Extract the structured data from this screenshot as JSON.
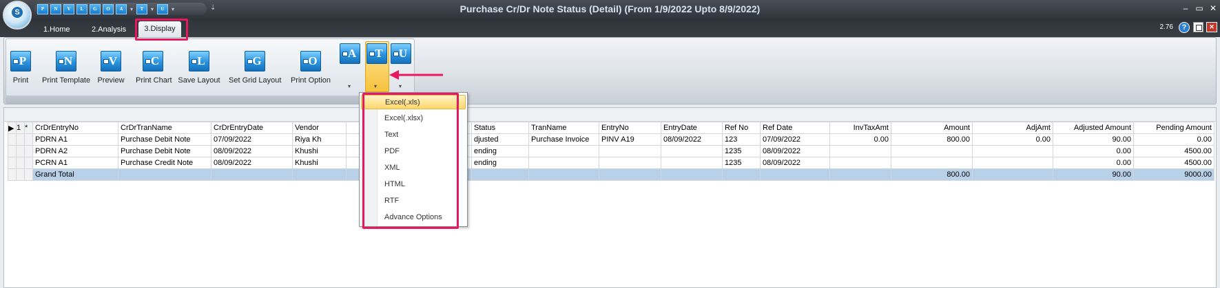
{
  "window": {
    "title": "Purchase Cr/Dr Note Status (Detail)  (From 1/9/2022 Upto 8/9/2022)",
    "minimize": "–",
    "maximize": "▭",
    "close": "✕",
    "version": "2.76"
  },
  "quick_access": [
    "P",
    "N",
    "V",
    "L",
    "G",
    "O",
    "A",
    "T",
    "U"
  ],
  "tabs": [
    {
      "label": "1.Home"
    },
    {
      "label": "2.Analysis"
    },
    {
      "label": "3.Display"
    }
  ],
  "ribbon": {
    "buttons": [
      {
        "letter": "P",
        "label": "Print"
      },
      {
        "letter": "N",
        "label": "Print Template"
      },
      {
        "letter": "V",
        "label": "Preview"
      },
      {
        "letter": "C",
        "label": "Print Chart"
      },
      {
        "letter": "L",
        "label": "Save Layout"
      },
      {
        "letter": "G",
        "label": "Set Grid Layout"
      },
      {
        "letter": "O",
        "label": "Print Option"
      }
    ],
    "small_buttons": [
      {
        "letter": "A"
      },
      {
        "letter": "T"
      },
      {
        "letter": "U"
      }
    ]
  },
  "export_menu": {
    "items": [
      "Excel(.xls)",
      "Excel(.xlsx)",
      "Text",
      "PDF",
      "XML",
      "HTML",
      "RTF",
      "Advance Options"
    ],
    "highlighted": "Excel(.xls)"
  },
  "grid": {
    "row_header": {
      "num": "1",
      "star": "*"
    },
    "columns": [
      "CrDrEntryNo",
      "CrDrTranName",
      "CrDrEntryDate",
      "Vendor",
      "",
      "Status",
      "TranName",
      "EntryNo",
      "EntryDate",
      "Ref No",
      "Ref Date",
      "InvTaxAmt",
      "Amount",
      "AdjAmt",
      "Adjusted Amount",
      "Pending Amount"
    ],
    "rows": [
      [
        "PDRN A1",
        "Purchase Debit Note",
        "07/09/2022",
        "Riya Kh",
        "",
        "djusted",
        "Purchase Invoice",
        "PINV A19",
        "08/09/2022",
        "123",
        "07/09/2022",
        "0.00",
        "800.00",
        "0.00",
        "90.00",
        "0.00"
      ],
      [
        "PDRN A2",
        "Purchase Debit Note",
        "08/09/2022",
        "Khushi",
        "",
        "ending",
        "",
        "",
        "",
        "1235",
        "08/09/2022",
        "",
        "",
        "",
        "0.00",
        "4500.00"
      ],
      [
        "PCRN A1",
        "Purchase Credit Note",
        "08/09/2022",
        "Khushi",
        "",
        "ending",
        "",
        "",
        "",
        "1235",
        "08/09/2022",
        "",
        "",
        "",
        "0.00",
        "4500.00"
      ]
    ],
    "total": [
      "Grand Total",
      "",
      "",
      "",
      "",
      "",
      "",
      "",
      "",
      "",
      "",
      "",
      "800.00",
      "",
      "90.00",
      "9000.00"
    ]
  }
}
